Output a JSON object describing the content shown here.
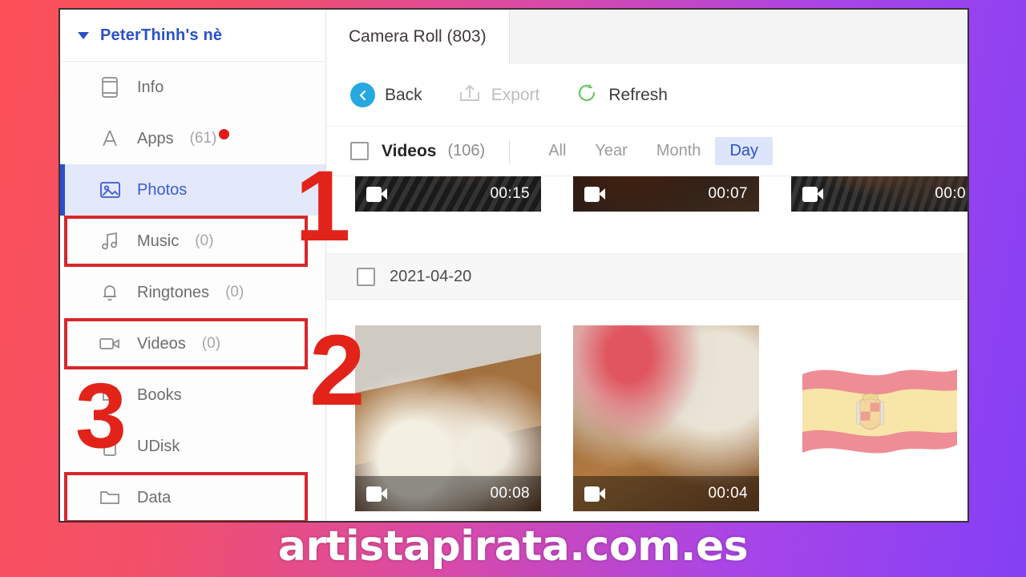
{
  "background": {
    "left_color": "#fc5058",
    "right_color": "#8440f5"
  },
  "sidebar": {
    "device": {
      "name": "PeterThinh's nè",
      "caret_icon": "chevron-down-icon"
    },
    "items": [
      {
        "label": "Info",
        "count": "",
        "icon": "phone-icon",
        "active": false,
        "boxed": false,
        "dot": false
      },
      {
        "label": "Apps",
        "count": "(61)",
        "icon": "appstore-icon",
        "active": false,
        "boxed": false,
        "dot": true
      },
      {
        "label": "Photos",
        "count": "",
        "icon": "photo-icon",
        "active": true,
        "boxed": false,
        "dot": false
      },
      {
        "label": "Music",
        "count": "(0)",
        "icon": "music-note-icon",
        "active": false,
        "boxed": true,
        "dot": false
      },
      {
        "label": "Ringtones",
        "count": "(0)",
        "icon": "bell-icon",
        "active": false,
        "boxed": false,
        "dot": false
      },
      {
        "label": "Videos",
        "count": "(0)",
        "icon": "video-icon",
        "active": false,
        "boxed": true,
        "dot": false
      },
      {
        "label": "Books",
        "count": "",
        "icon": "book-icon",
        "active": false,
        "boxed": false,
        "dot": false
      },
      {
        "label": "UDisk",
        "count": "",
        "icon": "usb-drive-icon",
        "active": false,
        "boxed": false,
        "dot": false
      },
      {
        "label": "Data",
        "count": "",
        "icon": "folder-icon",
        "active": false,
        "boxed": true,
        "dot": false
      }
    ]
  },
  "main": {
    "tab": {
      "label": "Camera Roll (803)"
    },
    "toolbar": {
      "back_label": "Back",
      "export_label": "Export",
      "refresh_label": "Refresh",
      "back_icon": "back-arrow-icon",
      "export_icon": "export-icon",
      "refresh_icon": "refresh-icon"
    },
    "filterbar": {
      "videos_label": "Videos",
      "videos_count": "(106)",
      "segments": [
        {
          "label": "All",
          "selected": false
        },
        {
          "label": "Year",
          "selected": false
        },
        {
          "label": "Month",
          "selected": false
        },
        {
          "label": "Day",
          "selected": true
        }
      ],
      "selected_accent": "#2b50c8"
    },
    "grid": {
      "row_top": [
        {
          "duration": "00:15",
          "icon": "video-badge-icon"
        },
        {
          "duration": "00:07",
          "icon": "video-badge-icon"
        },
        {
          "duration": "00:0",
          "icon": "video-badge-icon"
        }
      ],
      "date_group": {
        "date": "2021-04-20",
        "checkbox": "unchecked"
      },
      "row_bottom": [
        {
          "duration": "00:08",
          "icon": "video-badge-icon"
        },
        {
          "duration": "00:04",
          "icon": "video-badge-icon"
        }
      ]
    }
  },
  "annotations": {
    "color": "#e2231a",
    "numbers": [
      "1",
      "2",
      "3"
    ]
  },
  "overlay": {
    "flag_icon": "spain-flag-icon"
  },
  "watermark": {
    "text": "artistapirata.com.es"
  }
}
